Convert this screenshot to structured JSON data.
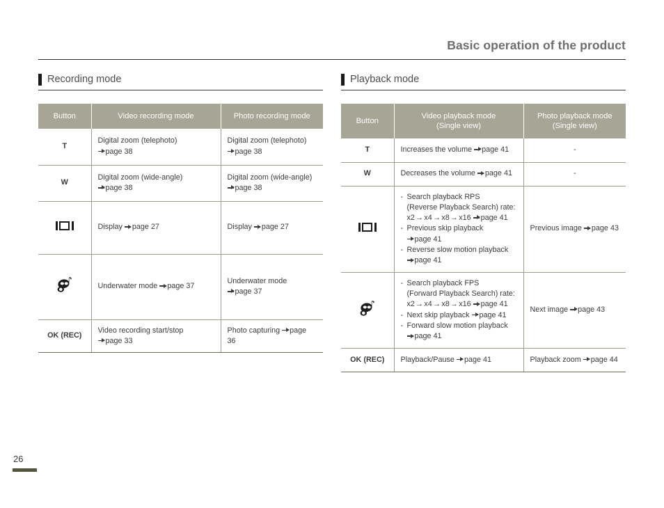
{
  "page": {
    "header_title": "Basic operation of the product",
    "page_number": "26"
  },
  "icons": {
    "display": "display-button-icon",
    "underwater": "underwater-mode-icon",
    "arrow": "page-reference-arrow-icon"
  },
  "colors": {
    "table_header_bg": "#a6a596",
    "table_border": "#9d9d8b",
    "footer_bar": "#55553f",
    "header_title_text": "#6d6e70",
    "section_bar": "#1a1a1a"
  },
  "recording": {
    "section_title": "Recording mode",
    "headers": {
      "button": "Button",
      "video": "Video recording mode",
      "photo": "Photo recording mode"
    },
    "rows": [
      {
        "button": "T",
        "video_line1": "Digital zoom (telephoto)",
        "video_line2": "page 38",
        "photo_line1": "Digital zoom (telephoto)",
        "photo_line2": "page 38"
      },
      {
        "button": "W",
        "video_line1": "Digital zoom (wide-angle)",
        "video_line2": "page 38",
        "photo_line1": "Digital zoom (wide-angle)",
        "photo_line2": "page 38"
      },
      {
        "button": "display-icon",
        "video_line1": "Display",
        "video_line2": "page 27",
        "photo_line1": "Display",
        "photo_line2": "page 27"
      },
      {
        "button": "underwater-icon",
        "video_line1": "Underwater mode",
        "video_line2": "page 37",
        "photo_line1": "Underwater mode",
        "photo_line2": "page 37"
      },
      {
        "button": "OK (REC)",
        "video_line1": "Video recording start/stop",
        "video_line2": "page 33",
        "photo_line1": "Photo capturing",
        "photo_line2": "page 36"
      }
    ]
  },
  "playback": {
    "section_title": "Playback mode",
    "headers": {
      "button": "Button",
      "video_line1": "Video playback mode",
      "video_line2": "(Single view)",
      "photo_line1": "Photo playback mode",
      "photo_line2": "(Single view)"
    },
    "rows": {
      "t": {
        "button": "T",
        "video_text": "Increases the volume",
        "video_page": "page 41",
        "photo_text": "-"
      },
      "w": {
        "button": "W",
        "video_text": "Decreases the volume",
        "video_page": "page 41",
        "photo_text": "-"
      },
      "display": {
        "button": "display-icon",
        "item1_line1": "Search playback RPS",
        "item1_line2": "(Reverse Playback Search) rate:",
        "item1_rate": [
          "x2",
          "x4",
          "x8",
          "x16"
        ],
        "item1_page": "page 41",
        "item2_line1": "Previous skip playback",
        "item2_page": "page 41",
        "item3_line1": "Reverse slow motion playback",
        "item3_page": "page 41",
        "photo_text": "Previous image",
        "photo_page": "page 43"
      },
      "underwater": {
        "button": "underwater-icon",
        "item1_line1": "Search playback FPS",
        "item1_line2": "(Forward Playback Search) rate:",
        "item1_rate": [
          "x2",
          "x4",
          "x8",
          "x16"
        ],
        "item1_page": "page 41",
        "item2_line1": "Next skip playback",
        "item2_page": "page 41",
        "item3_line1": "Forward slow motion playback",
        "item3_page": "page 41",
        "photo_text": "Next image",
        "photo_page": "page 43"
      },
      "ok": {
        "button": "OK (REC)",
        "video_text": "Playback/Pause",
        "video_page": "page 41",
        "photo_text": "Playback zoom",
        "photo_page": "page 44"
      }
    }
  }
}
